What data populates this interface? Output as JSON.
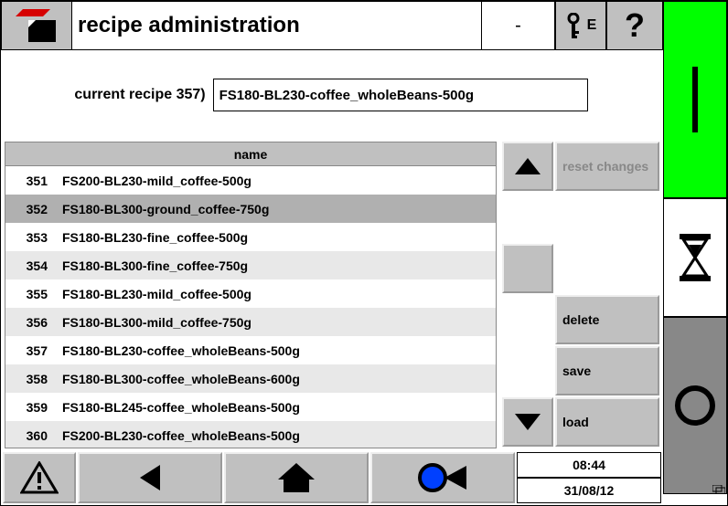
{
  "header": {
    "title": "recipe administration",
    "status": "-",
    "key_letter": "E"
  },
  "current": {
    "label": "current recipe 357)",
    "value": "FS180-BL230-coffee_wholeBeans-500g"
  },
  "table": {
    "col_name": "name",
    "rows": [
      {
        "id": "351",
        "name": "FS200-BL230-mild_coffee-500g"
      },
      {
        "id": "352",
        "name": "FS180-BL300-ground_coffee-750g"
      },
      {
        "id": "353",
        "name": "FS180-BL230-fine_coffee-500g"
      },
      {
        "id": "354",
        "name": "FS180-BL300-fine_coffee-750g"
      },
      {
        "id": "355",
        "name": "FS180-BL230-mild_coffee-500g"
      },
      {
        "id": "356",
        "name": "FS180-BL300-mild_coffee-750g"
      },
      {
        "id": "357",
        "name": "FS180-BL230-coffee_wholeBeans-500g"
      },
      {
        "id": "358",
        "name": "FS180-BL300-coffee_wholeBeans-600g"
      },
      {
        "id": "359",
        "name": "FS180-BL245-coffee_wholeBeans-500g"
      },
      {
        "id": "360",
        "name": "FS200-BL230-coffee_wholeBeans-500g"
      }
    ],
    "selected_index": 1
  },
  "buttons": {
    "reset": "reset changes",
    "delete": "delete",
    "save": "save",
    "load": "load"
  },
  "footer": {
    "time": "08:44",
    "date": "31/08/12"
  }
}
